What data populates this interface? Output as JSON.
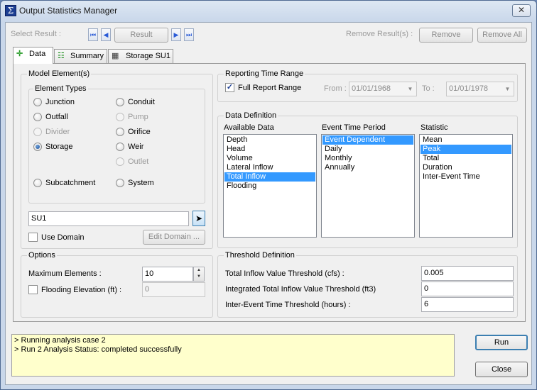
{
  "window": {
    "title": "Output Statistics Manager",
    "close_glyph": "✕",
    "app_glyph": "Σ"
  },
  "toolbar": {
    "select_result_label": "Select Result :",
    "first_glyph": "⏮",
    "prev_glyph": "◀",
    "result_label": "Result",
    "next_glyph": "▶",
    "last_glyph": "⏭",
    "remove_results_label": "Remove Result(s) :",
    "remove_label": "Remove",
    "remove_all_label": "Remove All"
  },
  "tabs": [
    {
      "label": "Data",
      "icon": "crosshair-icon"
    },
    {
      "label": "Summary",
      "icon": "list-icon"
    },
    {
      "label": "Storage SU1",
      "icon": "table-icon"
    }
  ],
  "model_elements": {
    "title": "Model Element(s)",
    "element_types_title": "Element Types",
    "types": [
      {
        "label": "Junction",
        "checked": false,
        "disabled": false
      },
      {
        "label": "Conduit",
        "checked": false,
        "disabled": false
      },
      {
        "label": "Outfall",
        "checked": false,
        "disabled": false
      },
      {
        "label": "Pump",
        "checked": false,
        "disabled": true
      },
      {
        "label": "Divider",
        "checked": false,
        "disabled": true
      },
      {
        "label": "Orifice",
        "checked": false,
        "disabled": false
      },
      {
        "label": "Storage",
        "checked": true,
        "disabled": false
      },
      {
        "label": "Weir",
        "checked": false,
        "disabled": false
      },
      {
        "label": "Outlet",
        "checked": false,
        "disabled": true
      },
      {
        "label": "Subcatchment",
        "checked": false,
        "disabled": false
      },
      {
        "label": "System",
        "checked": false,
        "disabled": false
      }
    ],
    "element_id_value": "SU1",
    "use_domain_label": "Use Domain",
    "edit_domain_label": "Edit Domain ..."
  },
  "options": {
    "title": "Options",
    "max_elements_label": "Maximum Elements :",
    "max_elements_value": "10",
    "flooding_elevation_label": "Flooding Elevation (ft) :",
    "flooding_elevation_value": "0"
  },
  "reporting": {
    "title": "Reporting Time Range",
    "full_range_label": "Full Report Range",
    "from_label": "From :",
    "from_value": "01/01/1968",
    "to_label": "To :",
    "to_value": "01/01/1978"
  },
  "data_definition": {
    "title": "Data Definition",
    "available_header": "Available Data",
    "available_items": [
      "Depth",
      "Head",
      "Volume",
      "Lateral Inflow",
      "Total Inflow",
      "Flooding"
    ],
    "available_selected": 4,
    "event_header": "Event Time Period",
    "event_items": [
      "Event Dependent",
      "Daily",
      "Monthly",
      "Annually"
    ],
    "event_selected": 0,
    "statistic_header": "Statistic",
    "statistic_items": [
      "Mean",
      "Peak",
      "Total",
      "Duration",
      "Inter-Event Time"
    ],
    "statistic_selected": 1
  },
  "threshold": {
    "title": "Threshold Definition",
    "rows": [
      {
        "label": "Total Inflow Value Threshold (cfs) :",
        "value": "0.005"
      },
      {
        "label": "Integrated Total Inflow Value Threshold (ft3)",
        "value": "0"
      },
      {
        "label": "Inter-Event Time Threshold (hours) :",
        "value": "6"
      }
    ]
  },
  "log": {
    "lines": [
      "> Running analysis case 2",
      "> Run 2 Analysis Status: completed successfully"
    ]
  },
  "actions": {
    "run_label": "Run",
    "close_label": "Close"
  },
  "colors": {
    "selection": "#3399ff",
    "log_background": "#ffffcc",
    "nav_arrow": "#2a5bd7"
  }
}
